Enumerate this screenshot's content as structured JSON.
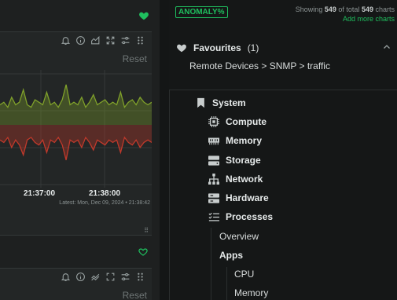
{
  "chart_panel": {
    "reset_label": "Reset",
    "reset_label_2": "Reset",
    "x_ticks": [
      "21:37:00",
      "21:38:00"
    ],
    "latest": "Latest: Mon, Dec 09, 2024 • 21:38:42"
  },
  "chart_data": {
    "type": "area",
    "title": "",
    "xlabel": "",
    "ylabel": "",
    "x_ticks": [
      "21:37:00",
      "21:38:00"
    ],
    "grid": true,
    "series": [
      {
        "color": "#7fa02a",
        "values": [
          8,
          9,
          7,
          11,
          8,
          9,
          14,
          8,
          7,
          10,
          9,
          8,
          13,
          8,
          9,
          7,
          10,
          16,
          8,
          9,
          8,
          11,
          7,
          9,
          12,
          8,
          9,
          10,
          8,
          9,
          8,
          13,
          7,
          9,
          10,
          8,
          11,
          9,
          8,
          9
        ]
      },
      {
        "color": "#c0392b",
        "values": [
          -6,
          -7,
          -5,
          -9,
          -6,
          -8,
          -12,
          -6,
          -5,
          -7,
          -8,
          -6,
          -11,
          -6,
          -7,
          -5,
          -8,
          -14,
          -6,
          -7,
          -6,
          -9,
          -5,
          -7,
          -10,
          -6,
          -7,
          -8,
          -6,
          -7,
          -6,
          -11,
          -5,
          -7,
          -8,
          -6,
          -9,
          -7,
          -6,
          -7
        ]
      }
    ],
    "colors": {
      "sent": "#7fa02a",
      "received": "#c0392b"
    }
  },
  "sidebar": {
    "anomaly_label": "ANOMALY%",
    "showing_prefix": "Showing",
    "showing_count": "549",
    "showing_mid": "of total",
    "total_count": "549",
    "showing_suffix": "charts",
    "add_more": "Add more charts",
    "favourites_title": "Favourites",
    "favourites_count": "(1)",
    "favourite_path": "Remote Devices > SNMP > traffic",
    "tree": [
      {
        "label": "System",
        "icon": "bookmark-icon"
      },
      {
        "label": "Compute",
        "icon": "cpu-icon"
      },
      {
        "label": "Memory",
        "icon": "memory-icon"
      },
      {
        "label": "Storage",
        "icon": "storage-icon"
      },
      {
        "label": "Network",
        "icon": "network-icon"
      },
      {
        "label": "Hardware",
        "icon": "hardware-icon"
      },
      {
        "label": "Processes",
        "icon": "list-icon"
      },
      {
        "label": "Overview"
      },
      {
        "label": "Apps"
      },
      {
        "label": "CPU"
      },
      {
        "label": "Memory"
      }
    ]
  },
  "colors": {
    "accent": "#1fbf5e",
    "background": "#1a1c1c"
  }
}
